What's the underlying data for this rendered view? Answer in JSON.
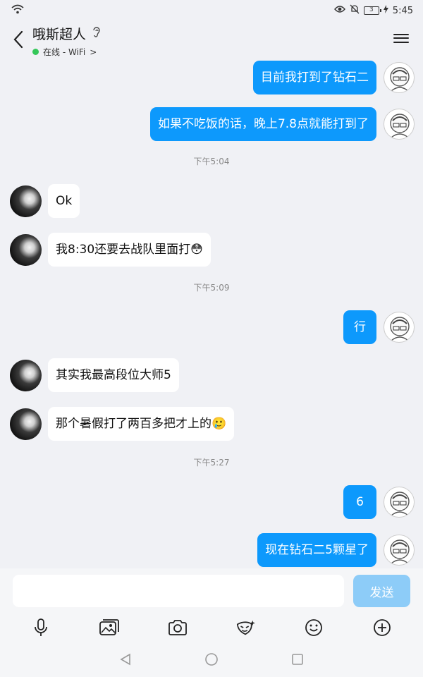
{
  "status_bar": {
    "time": "5:45",
    "battery": "3"
  },
  "header": {
    "title": "哦斯超人",
    "presence": "在线 - WiFi",
    "presence_chevron": ">"
  },
  "messages": [
    {
      "side": "right",
      "text": "目前我打到了钻石二"
    },
    {
      "side": "right",
      "text": "如果不吃饭的话，晚上7.8点就能打到了"
    },
    {
      "type": "time",
      "text": "下午5:04"
    },
    {
      "side": "left",
      "text": "Ok"
    },
    {
      "side": "left",
      "text": "我8:30还要去战队里面打😳"
    },
    {
      "type": "time",
      "text": "下午5:09"
    },
    {
      "side": "right",
      "text": "行"
    },
    {
      "side": "left",
      "text": "其实我最高段位大师5"
    },
    {
      "side": "left",
      "text": "那个暑假打了两百多把才上的🥲"
    },
    {
      "type": "time",
      "text": "下午5:27"
    },
    {
      "side": "right",
      "text": "6"
    },
    {
      "side": "right",
      "text": "现在钻石二5颗星了"
    }
  ],
  "input": {
    "placeholder": "",
    "send_label": "发送"
  },
  "toolbar": [
    "mic-icon",
    "image-icon",
    "camera-icon",
    "sticker-icon",
    "emoji-icon",
    "plus-icon"
  ],
  "nav": [
    "back-triangle-icon",
    "home-circle-icon",
    "recent-square-icon"
  ],
  "colors": {
    "outgoing_bubble": "#0d99fc",
    "incoming_bubble": "#ffffff",
    "send_button": "#8dccf8",
    "online": "#34c759"
  }
}
